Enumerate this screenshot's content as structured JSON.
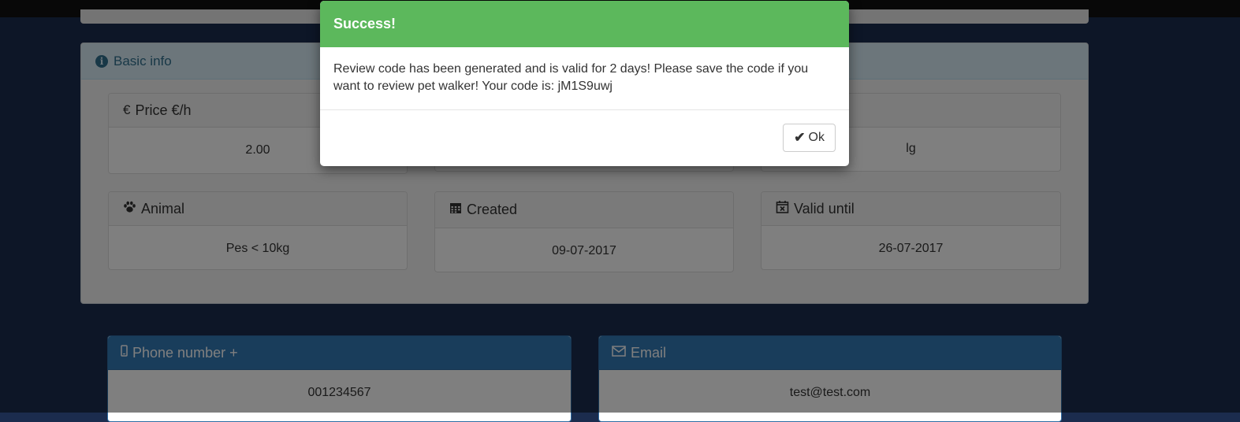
{
  "basic_info": {
    "title": "Basic info",
    "fields": {
      "price": {
        "label": "Price €/h",
        "value": "2.00"
      },
      "size": {
        "value": "lg"
      },
      "animal": {
        "label": "Animal",
        "value": "Pes < 10kg"
      },
      "created": {
        "label": "Created",
        "value": "09-07-2017"
      },
      "valid_until": {
        "label": "Valid until",
        "value": "26-07-2017"
      }
    }
  },
  "contact": {
    "phone": {
      "label": "Phone number +",
      "value": "001234567"
    },
    "email": {
      "label": "Email",
      "value": "test@test.com"
    }
  },
  "modal": {
    "title": "Success!",
    "message": "Review code has been generated and is valid for 2 days! Please save the code if you want to review pet walker! Your code is: jM1S9uwj",
    "ok_label": "Ok"
  },
  "colors": {
    "success_header": "#5cb85c",
    "info_header": "#d9edf7",
    "primary_header": "#337ab7",
    "background": "#1b2c4e"
  },
  "icons": {
    "basic_info": "info-circle-icon",
    "price": "euro-icon",
    "animal": "paw-icon",
    "created": "calendar-icon",
    "valid_until": "calendar-times-icon",
    "phone": "mobile-phone-icon",
    "email": "envelope-icon",
    "ok": "check-icon"
  }
}
